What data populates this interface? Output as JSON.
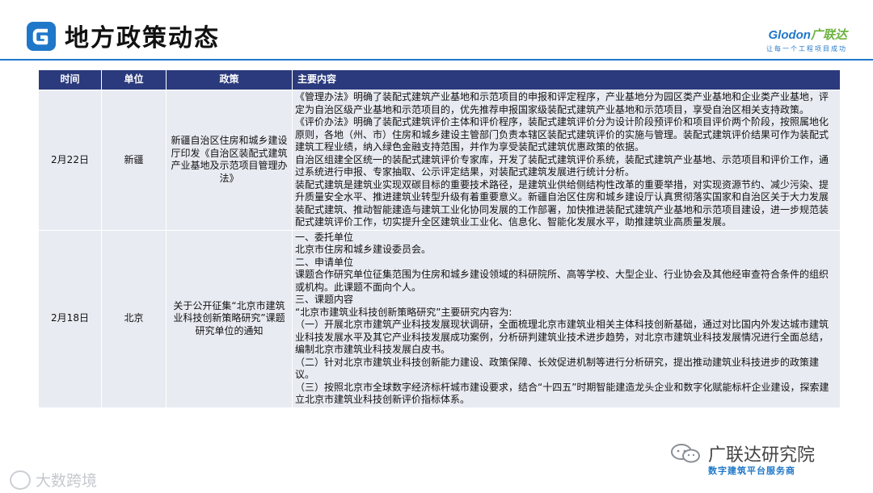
{
  "header": {
    "title": "地方政策动态",
    "brand_name_latin": "Glodon",
    "brand_name_cn": "广联达",
    "brand_slogan": "让每一个工程项目成功",
    "accent_color": "#1f77c9",
    "logo_icon": "glodon-g-logo-icon"
  },
  "table": {
    "header_color": "#2b3a7c",
    "row_color": "#e9ebf2",
    "columns": [
      "时间",
      "单位",
      "政策",
      "主要内容"
    ],
    "rows": [
      {
        "date": "2月22日",
        "unit": "新疆",
        "policy": "新疆自治区住房和城乡建设厅印发《自治区装配式建筑产业基地及示范项目管理办法》",
        "content": [
          "《管理办法》明确了装配式建筑产业基地和示范项目的申报和评定程序，产业基地分为园区类产业基地和企业类产业基地，评定为自治区级产业基地和示范项目的，优先推荐申报国家级装配式建筑产业基地和示范项目，享受自治区相关支持政策。",
          "《评价办法》明确了装配式建筑评价主体和评价程序，装配式建筑评价分为设计阶段预评价和项目评价两个阶段，按照属地化原则，各地（州、市）住房和城乡建设主管部门负责本辖区装配式建筑评价的实施与管理。装配式建筑评价结果可作为装配式建筑工程业绩，纳入绿色金融支持范围，并作为享受装配式建筑优惠政策的依据。",
          "自治区组建全区统一的装配式建筑评价专家库，开发了装配式建筑评价系统，装配式建筑产业基地、示范项目和评价工作，通过系统进行申报、专家抽取、公示评定结果，对装配式建筑发展进行统计分析。",
          "装配式建筑是建筑业实现双碳目标的重要技术路径，是建筑业供给侧结构性改革的重要举措，对实现资源节约、减少污染、提升质量安全水平、推进建筑业转型升级有着重要意义。新疆自治区住房和城乡建设厅认真贯彻落实国家和自治区关于大力发展装配式建筑、推动智能建造与建筑工业化协同发展的工作部署，加快推进装配式建筑产业基地和示范项目建设，进一步规范装配式建筑评价工作，切实提升全区建筑业工业化、信息化、智能化发展水平，助推建筑业高质量发展。"
        ]
      },
      {
        "date": "2月18日",
        "unit": "北京",
        "policy": "关于公开征集“北京市建筑业科技创新策略研究”课题研究单位的通知",
        "content": [
          "一、委托单位",
          "北京市住房和城乡建设委员会。",
          "二、申请单位",
          "课题合作研究单位征集范围为住房和城乡建设领域的科研院所、高等学校、大型企业、行业协会及其他经审查符合条件的组织或机构。此课题不面向个人。",
          "三、课题内容",
          "“北京市建筑业科技创新策略研究”主要研究内容为:",
          "（一）开展北京市建筑产业科技发展现状调研，全面梳理北京市建筑业相关主体科技创新基础，通过对比国内外发达城市建筑业科技发展水平及其它产业科技发展成功案例，分析研判建筑业技术进步趋势，对北京市建筑业科技发展情况进行全面总结，编制北京市建筑业科技发展白皮书。",
          "（二）针对北京市建筑业科技创新能力建设、政策保障、长效促进机制等进行分析研究，提出推动建筑业科技进步的政策建议。",
          "（三）按照北京市全球数字经济标杆城市建设要求，结合“十四五”时期智能建造龙头企业和数字化赋能标杆企业建设，探索建立北京市建筑业科技创新评价指标体系。"
        ]
      }
    ]
  },
  "watermarks": {
    "left_text": "大数跨境",
    "wechat_name": "广联达研究院",
    "platform_tag": "数字建筑平台服务商"
  }
}
